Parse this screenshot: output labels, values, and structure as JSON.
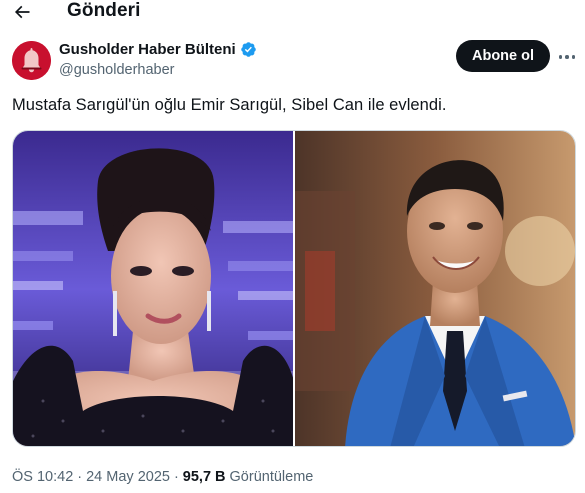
{
  "header": {
    "title": "Gönderi",
    "back_icon": "arrow-left-icon"
  },
  "author": {
    "name": "Gusholder Haber Bülteni",
    "handle": "@gusholderhaber",
    "verified": true,
    "verified_color": "#1d9bf0",
    "avatar_icon": "bell-icon",
    "avatar_color": "#c8102e"
  },
  "actions": {
    "follow_label": "Abone ol",
    "more_icon": "more-dots-icon"
  },
  "tweet": {
    "text": "Mustafa Sarıgül'ün oğlu Emir Sarıgül, Sibel Can ile evlendi."
  },
  "media": {
    "count": 2
  },
  "meta": {
    "time": "ÖS 10:42",
    "separator": "·",
    "date": "24 May 2025",
    "views_count": "95,7 B",
    "views_label": "Görüntüleme"
  }
}
